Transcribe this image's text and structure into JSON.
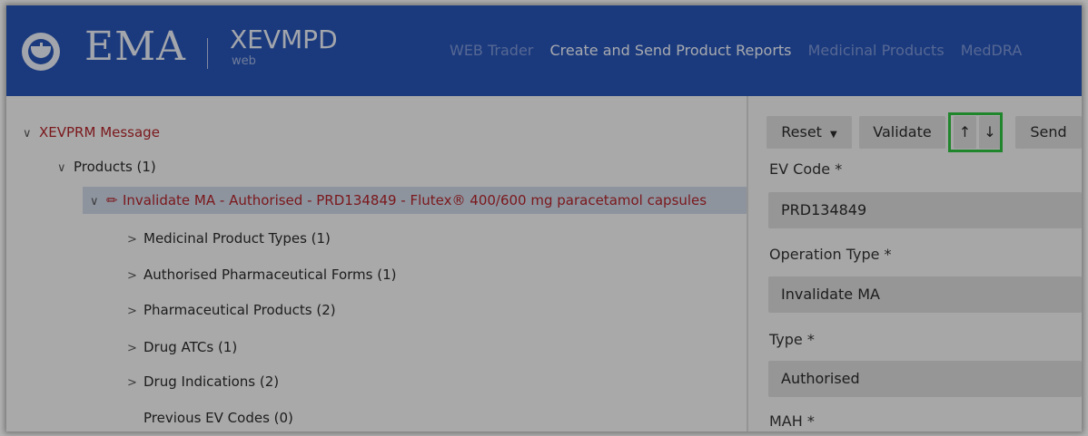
{
  "header": {
    "logo_text": "EMA",
    "product_name": "XEVMPD",
    "product_sub": "web",
    "nav": [
      {
        "label": "WEB Trader",
        "active": false
      },
      {
        "label": "Create and Send Product Reports",
        "active": true
      },
      {
        "label": "Medicinal Products",
        "active": false
      },
      {
        "label": "MedDRA",
        "active": false
      }
    ]
  },
  "tree": {
    "root": "XEVPRM Message",
    "products": "Products (1)",
    "selected_product": "Invalidate MA - Authorised - PRD134849 - Flutex® 400/600 mg paracetamol capsules",
    "children": [
      "Medicinal Product Types (1)",
      "Authorised Pharmaceutical Forms (1)",
      "Pharmaceutical Products (2)",
      "Drug ATCs (1)",
      "Drug Indications (2)",
      "Previous EV Codes (0)"
    ]
  },
  "toolbar": {
    "reset_label": "Reset",
    "validate_label": "Validate",
    "up_label": "↑",
    "down_label": "↓",
    "send_label": "Send"
  },
  "form": {
    "ev_code_label": "EV Code *",
    "ev_code_value": "PRD134849",
    "operation_type_label": "Operation Type *",
    "operation_type_value": "Invalidate MA",
    "type_label": "Type *",
    "type_value": "Authorised",
    "mah_label": "MAH *"
  },
  "colors": {
    "header_bg": "#2753b3",
    "accent_red": "#b0242a",
    "highlight_green": "#2ec13f"
  }
}
